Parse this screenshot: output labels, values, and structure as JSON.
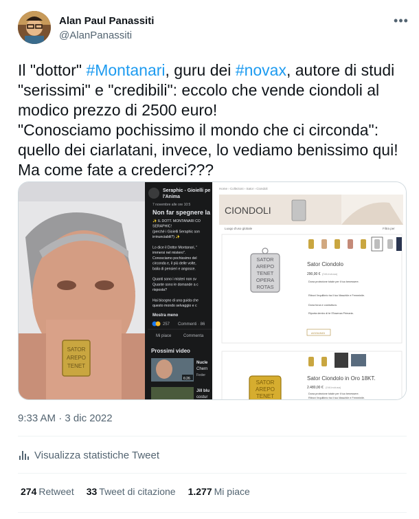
{
  "author": {
    "name": "Alan Paul Panassiti",
    "handle": "@AlanPanassiti"
  },
  "tweet": {
    "segments": [
      {
        "line": 0,
        "parts": [
          {
            "text": "Il \"dottor\" ",
            "type": "text"
          },
          {
            "text": "#Montanari",
            "type": "hashtag"
          },
          {
            "text": ", guru dei ",
            "type": "text"
          },
          {
            "text": "#novax",
            "type": "hashtag"
          },
          {
            "text": ", autore di studi",
            "type": "text"
          }
        ]
      },
      {
        "line": 1,
        "parts": [
          {
            "text": "\"serissimi\" e \"credibili\": eccolo che vende ciondoli al",
            "type": "text"
          }
        ]
      },
      {
        "line": 2,
        "parts": [
          {
            "text": "modico prezzo di 2500 euro!",
            "type": "text"
          }
        ]
      },
      {
        "line": 3,
        "parts": [
          {
            "text": "\"Conosciamo pochissimo il mondo che ci circonda\":",
            "type": "text"
          }
        ]
      },
      {
        "line": 4,
        "parts": [
          {
            "text": "quello dei ciarlatani, invece, lo vediamo benissimo qui!",
            "type": "text"
          }
        ]
      },
      {
        "line": 5,
        "parts": [
          {
            "text": "Ma come fate a crederci???",
            "type": "text"
          }
        ]
      }
    ]
  },
  "media": {
    "fb": {
      "page": "Seraphic - Gioielli pe",
      "page2": "l'Anima",
      "date": "7 novembre alle ore 10:5",
      "headline": "Non far spegnere la",
      "lines": [
        "✨ IL DOTT. MONTANARI CO",
        "SERAPHIC!",
        "(perché i Gioielli Seraphic son",
        "irrinunciabili?) ✨",
        "",
        "Lo dice il Dottor Montanari, \"",
        "immersi nel mistero\".",
        "Conosciamo pochissimo del",
        "circonda e, il più delle volte,",
        "balia di pensieri e angosce.",
        "",
        "Quanti sono i misteri non sv",
        "Quante sono le domande a c",
        "risposta?",
        "",
        "Hai bisogno di una guida che",
        "questo mondo selvaggio e c"
      ],
      "more": "Mostra meno",
      "reactions": "257",
      "comments": "Commenti · 86",
      "like": "Mi piace",
      "comment": "Commenta",
      "next_videos": "Prossimi video",
      "video1_title": "Nucle",
      "video1_sub": "Chern",
      "video1_sub2": "Feder",
      "video1_time": "6:26",
      "video2_title": "Jill blu",
      "video2_sub": "costur"
    },
    "shop": {
      "breadcrumb": "Home › Collezioni › Sator › Ciondoli",
      "banner_title": "CIONDOLI",
      "sort_label": "Luogo d'uso globale",
      "filter_label": "Filtra per",
      "product1": {
        "name": "Sator Ciondolo",
        "price": "290,00 €",
        "price_note": "(IVA inclusa)",
        "bullets": [
          "Dona protezione totale per il tuo benessere.",
          "Ritrovi l'equilibrio tra il tuo Maschile e Femminile.",
          "Dona forza e costruttura.",
          "Riporta dentro di te l'Essenza Primaria."
        ],
        "button": "AGGIUNGI"
      },
      "product2": {
        "name": "Sator Ciondolo in Oro 18KT.",
        "price": "2.480,00 €",
        "price_note": "(IVA inclusa)",
        "bullets": [
          "Dona protezione totale per il tuo benessere.",
          "Ritrovi l'equilibrio tra il tuo Maschile e Femminile."
        ]
      },
      "pendant_words": [
        "SATOR",
        "AREPO",
        "TENET",
        "OPERA",
        "ROTAS"
      ]
    }
  },
  "meta": {
    "time": "9:33 AM",
    "separator": "·",
    "date": "3 dic 2022",
    "stats_label": "Visualizza statistiche Tweet"
  },
  "counts": {
    "retweets": "274",
    "retweets_label": "Retweet",
    "quotes": "33",
    "quotes_label": "Tweet di citazione",
    "likes": "1.277",
    "likes_label": "Mi piace"
  },
  "colors": {
    "link": "#1d9bf0",
    "secondary": "#536471",
    "gold": "#c9a640",
    "fb_dark": "#18191a"
  }
}
